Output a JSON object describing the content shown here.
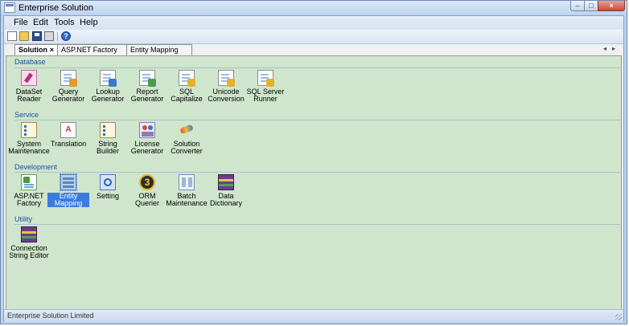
{
  "window": {
    "title": "Enterprise Solution"
  },
  "menu": [
    "File",
    "Edit",
    "Tools",
    "Help"
  ],
  "toolbar": {
    "icons": [
      "new-document-icon",
      "open-folder-icon",
      "save-disk-icon",
      "print-icon",
      "help-icon"
    ],
    "help_glyph": "?"
  },
  "tabs": [
    {
      "label": "Solution",
      "active": true,
      "close": "×"
    },
    {
      "label": "ASP.NET Factory",
      "active": false
    },
    {
      "label": "Entity Mapping",
      "active": false
    }
  ],
  "groups": [
    {
      "title": "Database",
      "items": [
        {
          "label": "DataSet Reader",
          "icon": "dataset-reader-icon"
        },
        {
          "label": "Query Generator",
          "icon": "query-generator-icon"
        },
        {
          "label": "Lookup Generator",
          "icon": "lookup-generator-icon"
        },
        {
          "label": "Report Generator",
          "icon": "report-generator-icon"
        },
        {
          "label": "SQL Capitalize",
          "icon": "sql-capitalize-icon"
        },
        {
          "label": "Unicode Conversion",
          "icon": "unicode-conversion-icon"
        },
        {
          "label": "SQL Server Runner",
          "icon": "sql-server-runner-icon"
        }
      ]
    },
    {
      "title": "Service",
      "items": [
        {
          "label": "System Maintenance",
          "icon": "system-maintenance-icon"
        },
        {
          "label": "Translation",
          "icon": "translation-icon"
        },
        {
          "label": "String Builder",
          "icon": "string-builder-icon"
        },
        {
          "label": "License Generator",
          "icon": "license-generator-icon"
        },
        {
          "label": "Solution Converter",
          "icon": "solution-converter-icon"
        }
      ]
    },
    {
      "title": "Development",
      "items": [
        {
          "label": "ASP.NET Factory",
          "icon": "aspnet-factory-icon"
        },
        {
          "label": "Entity Mapping",
          "icon": "entity-mapping-icon",
          "selected": true
        },
        {
          "label": "Setting",
          "icon": "setting-icon"
        },
        {
          "label": "ORM Querier",
          "icon": "orm-querier-icon"
        },
        {
          "label": "Batch Maintenance",
          "icon": "batch-maintenance-icon"
        },
        {
          "label": "Data Dictionary",
          "icon": "data-dictionary-icon"
        }
      ]
    },
    {
      "title": "Utility",
      "items": [
        {
          "label": "Connection String Editor",
          "icon": "connection-string-editor-icon"
        }
      ]
    }
  ],
  "status": {
    "text": "Enterprise Solution Limited"
  }
}
